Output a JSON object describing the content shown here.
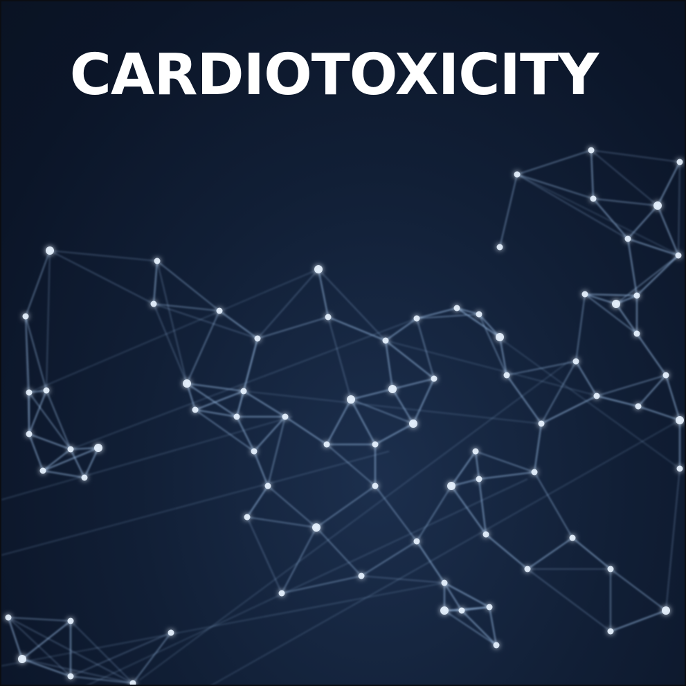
{
  "title": "CARDIOTOXICITY",
  "colors": {
    "background": "#0b1528",
    "title_text": "#ffffff",
    "network_line": "#9fc2ea",
    "network_node": "#e8f3ff",
    "border": "#0b0d12"
  },
  "image": {
    "subject": "network-mesh-illustration"
  }
}
